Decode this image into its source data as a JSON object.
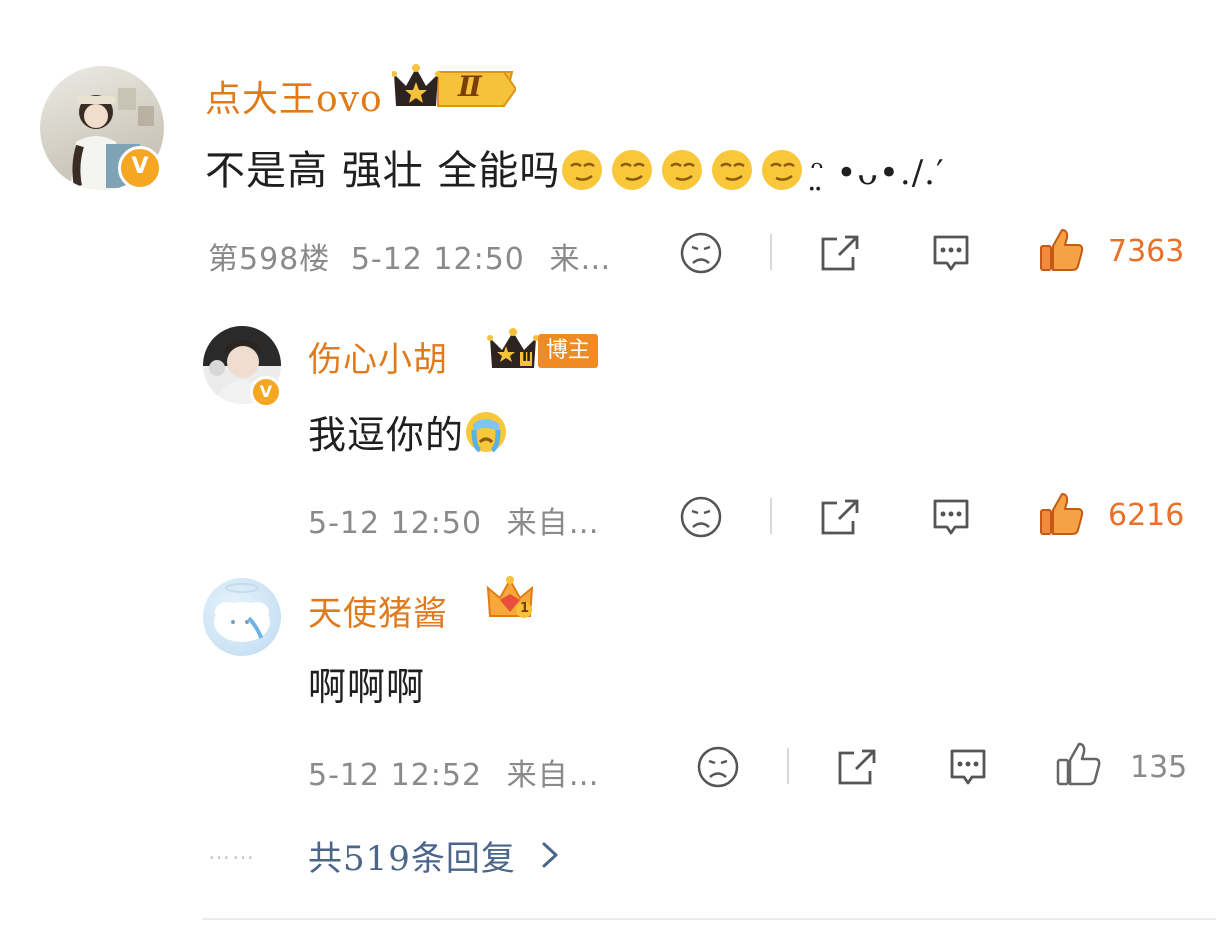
{
  "comment": {
    "username": "点大王ovo",
    "level_badge": "Ⅱ",
    "text_prefix": "不是高 强壮 全能吗",
    "text_suffix": "ᵔ̤ •ᴗ•./.′",
    "floor": "第598楼",
    "time": "5-12 12:50",
    "source": "来…",
    "likes": "7363"
  },
  "replies": [
    {
      "username": "伤心小胡",
      "badge_label": "博主",
      "level_badge": "Ⅱ",
      "text": "我逗你的",
      "time": "5-12 12:50",
      "source": "来自…",
      "likes": "6216"
    },
    {
      "username": "天使猪酱",
      "level_badge": "1",
      "text": "啊啊啊",
      "time": "5-12 12:52",
      "source": "来自…",
      "likes": "135"
    }
  ],
  "footer": {
    "dots": "……",
    "more_replies": "共519条回复"
  },
  "colors": {
    "accent_orange": "#e8712a",
    "username_orange": "#e07b1c",
    "link_blue": "#4a6688",
    "meta_gray": "#8a8a8a"
  },
  "icons": [
    "dislike-face-icon",
    "share-icon",
    "comment-icon",
    "like-thumb-icon",
    "chevron-right-icon"
  ]
}
